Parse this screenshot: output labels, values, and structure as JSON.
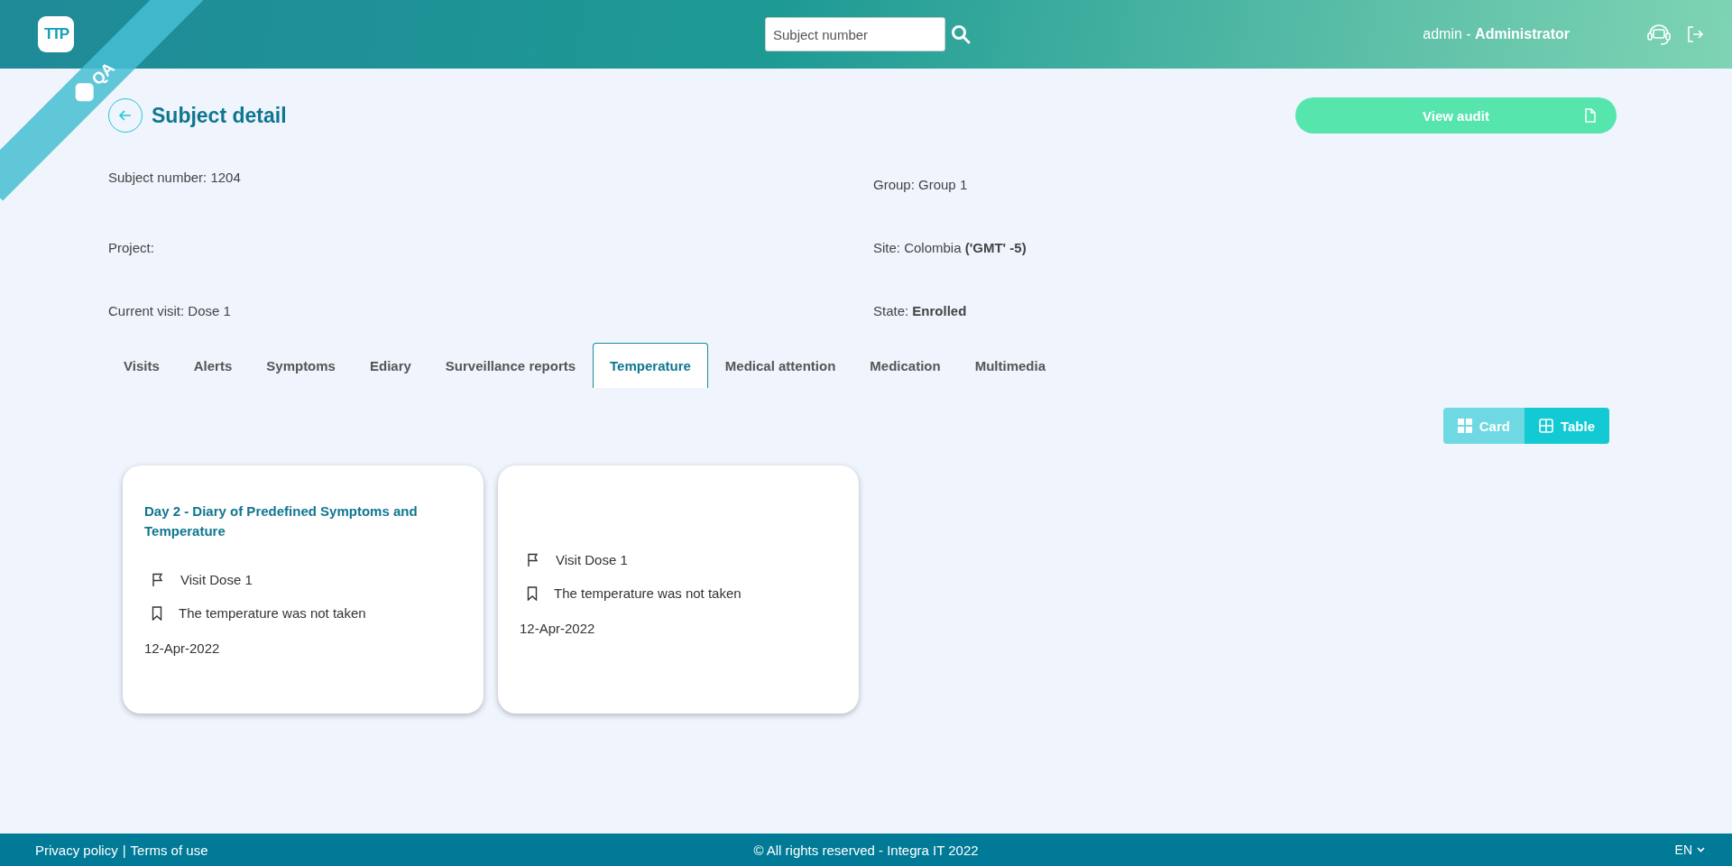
{
  "header": {
    "logo": "TTP",
    "ribbon": "QA",
    "search": {
      "placeholder": "Subject number"
    },
    "user": "admin - **Administrator**"
  },
  "page": {
    "title": "Subject detail",
    "audit_button": "View audit"
  },
  "info": [
    {
      "label": "Subject number:",
      "value": "1204"
    },
    {
      "label": "Group:",
      "value": "Group 1"
    },
    {
      "label": "Project:"
    },
    {
      "label": "Site:",
      "value": "Colombia **('GMT' -5)**"
    },
    {
      "label": "Current visit:",
      "value": "Dose 1"
    },
    {
      "label": "State:",
      "value": "**Enrolled**"
    }
  ],
  "tabs": [
    {
      "label": "Visits",
      "selected": false
    },
    {
      "label": "Alerts",
      "selected": false
    },
    {
      "label": "Symptoms",
      "selected": false
    },
    {
      "label": "Ediary",
      "selected": false
    },
    {
      "label": "Surveillance reports",
      "selected": false
    },
    {
      "label": "Temperature",
      "selected": true
    },
    {
      "label": "Medical attention",
      "selected": false
    },
    {
      "label": "Medication",
      "selected": false
    },
    {
      "label": "Multimedia",
      "selected": false
    }
  ],
  "view_toggle": [
    {
      "label": "Card",
      "kind": "card",
      "selected": true
    },
    {
      "label": "Table",
      "kind": "table",
      "selected": false
    }
  ],
  "cards": [
    {
      "title": "Day 2 - Diary of Predefined Symptoms and Temperature",
      "lines": [
        {
          "kind": "visit",
          "text": "Visit Dose 1"
        },
        {
          "kind": "note",
          "text": "The temperature was not taken"
        }
      ],
      "date": "12-Apr-2022"
    },
    {
      "lines": [
        {
          "kind": "visit",
          "text": "Visit Dose 1"
        },
        {
          "kind": "note",
          "text": "The temperature was not taken"
        }
      ],
      "date": "12-Apr-2022"
    }
  ],
  "footer": {
    "links": [
      "Privacy policy",
      "Terms of use"
    ],
    "separator": "|",
    "copyright": "© All rights reserved - Integra IT 2022",
    "language": "EN"
  }
}
